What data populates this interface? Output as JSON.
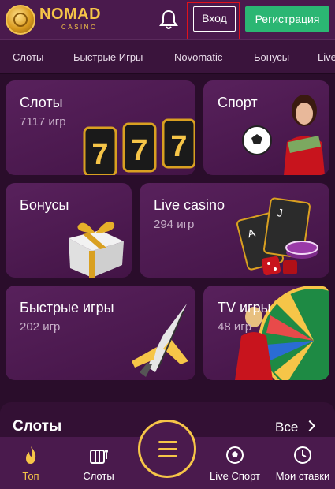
{
  "header": {
    "brand": "NOMAD",
    "brand_sub": "CASINO",
    "login_label": "Вход",
    "register_label": "Регистрация"
  },
  "nav": [
    "Слоты",
    "Быстрые Игры",
    "Novomatic",
    "Бонусы",
    "Live"
  ],
  "cards": [
    {
      "title": "Слоты",
      "count": "7117 игр"
    },
    {
      "title": "Спорт",
      "count": ""
    },
    {
      "title": "Бонусы",
      "count": ""
    },
    {
      "title": "Live casino",
      "count": "294 игр"
    },
    {
      "title": "Быстрые игры",
      "count": "202 игр"
    },
    {
      "title": "TV игры",
      "count": "48 игр"
    }
  ],
  "section": {
    "title": "Слоты",
    "all_label": "Все"
  },
  "tabbar": [
    {
      "label": "Топ",
      "icon": "fire-icon",
      "active": true
    },
    {
      "label": "Слоты",
      "icon": "slot-machine-icon",
      "active": false
    },
    {
      "label": "Live Спорт",
      "icon": "soccer-ball-icon",
      "active": false
    },
    {
      "label": "Мои ставки",
      "icon": "clock-icon",
      "active": false
    }
  ],
  "colors": {
    "accent": "#f6c548",
    "register": "#2bb673",
    "highlight": "#e0121b",
    "background": "#2a0d2b"
  }
}
